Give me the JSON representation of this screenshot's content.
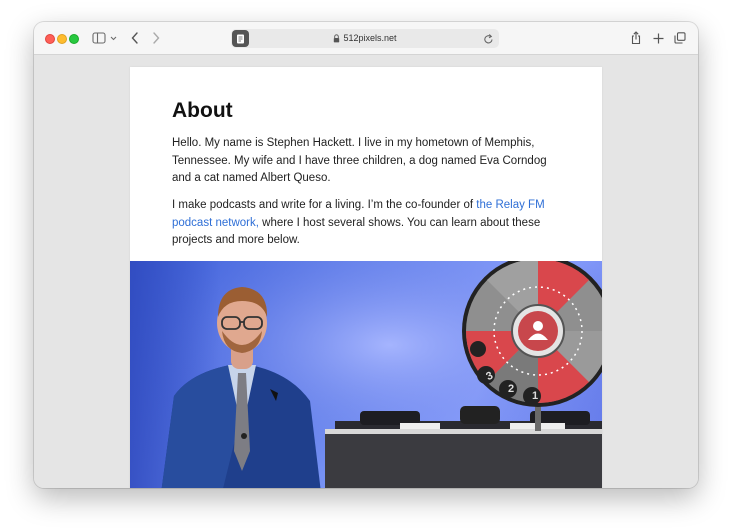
{
  "browser": {
    "url": "512pixels.net",
    "lock_icon": "lock-icon",
    "colors": {
      "toolbar": "#f6f6f6",
      "chrome_bg": "#e5e5e5"
    }
  },
  "page": {
    "title": "About",
    "paragraph1": "Hello. My name is Stephen Hackett. I live in my hometown of Memphis, Tennessee. My wife and I have three children, a dog named Eva Corndog and a cat named Albert Queso.",
    "paragraph2_before": "I make podcasts and write for a living. I’m the co-founder of ",
    "paragraph2_link": "the Relay FM podcast network,",
    "paragraph2_after": " where I host several shows. You can learn about these projects and more below.",
    "link_color": "#2f6fd6",
    "wheel_numbers": [
      "3",
      "2",
      "1"
    ]
  }
}
